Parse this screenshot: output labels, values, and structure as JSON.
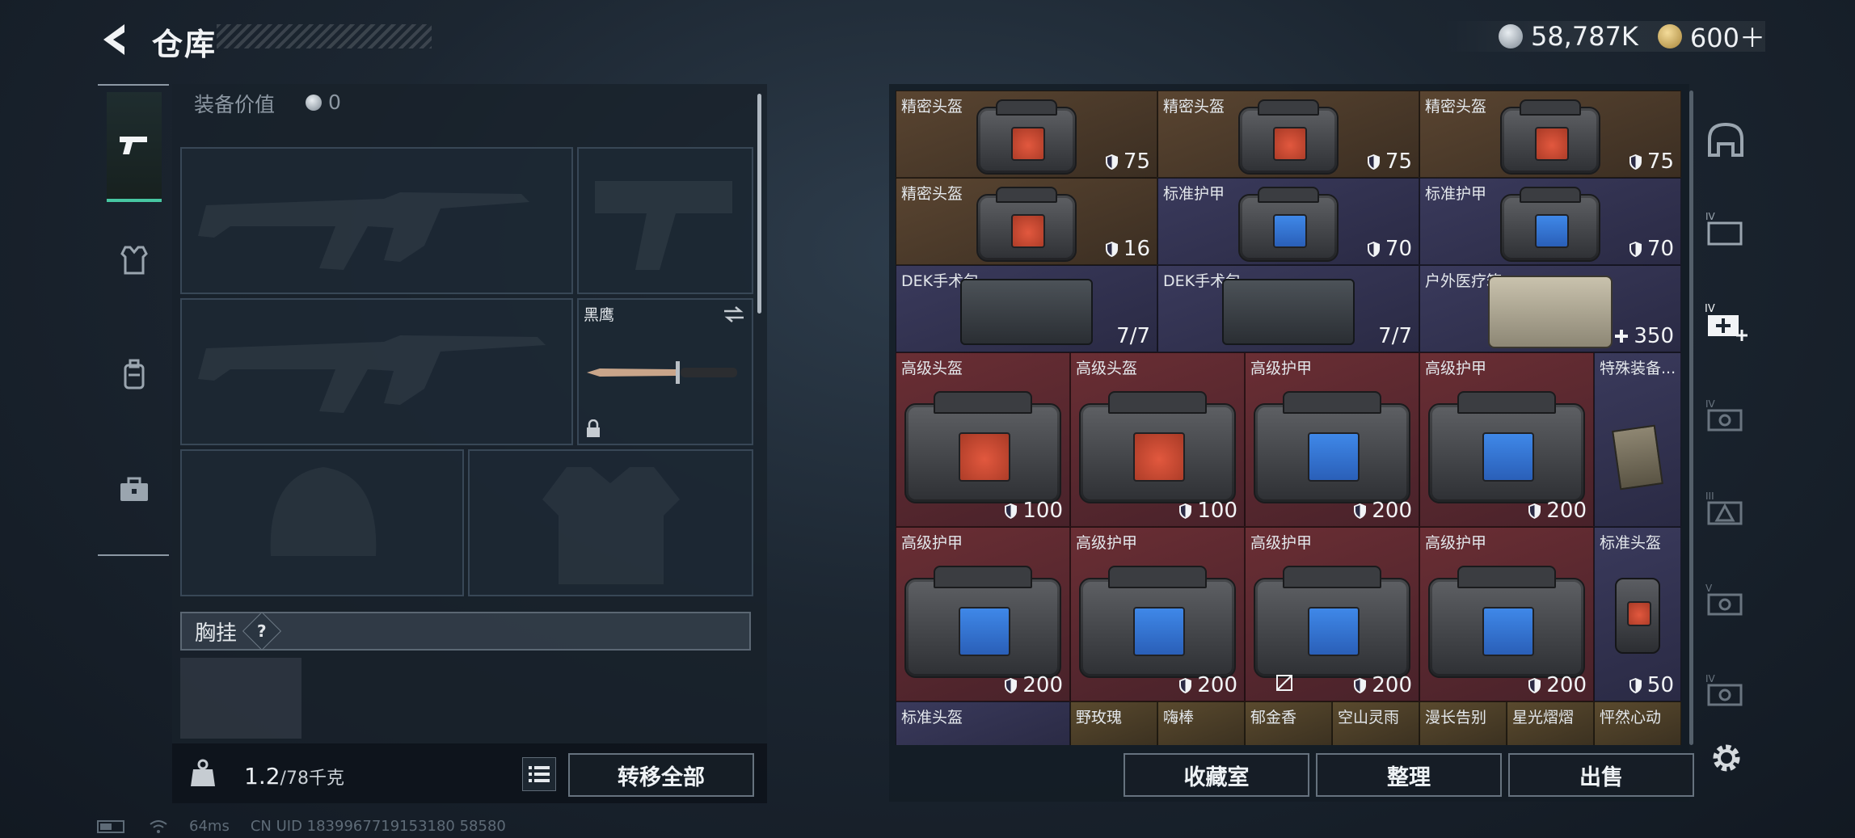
{
  "header": {
    "title": "仓库",
    "silver": "58,787K",
    "gold": "600＋"
  },
  "left_tabs": [
    {
      "icon": "pistol-icon",
      "active": true
    },
    {
      "icon": "armor-vest-icon",
      "active": false
    },
    {
      "icon": "backpack-icon",
      "active": false
    },
    {
      "icon": "toolbox-icon",
      "active": false
    }
  ],
  "loadout": {
    "equip_label": "装备价值",
    "equip_value": "0",
    "melee": {
      "name": "黑鹰"
    },
    "chest_rig_label": "胸挂",
    "help": "?",
    "weight_current": "1.2",
    "weight_max": "/78千克",
    "transfer_all": "转移全部"
  },
  "storage": {
    "rows": [
      [
        {
          "name": "精密头盔",
          "value": "75",
          "bg": "brown",
          "type": "helmet-red"
        },
        {
          "name": "精密头盔",
          "value": "75",
          "bg": "brown",
          "type": "helmet-red"
        },
        {
          "name": "精密头盔",
          "value": "75",
          "bg": "brown",
          "type": "helmet-red"
        }
      ],
      [
        {
          "name": "精密头盔",
          "value": "16",
          "bg": "brown",
          "type": "helmet-red"
        },
        {
          "name": "标准护甲",
          "value": "70",
          "bg": "purple",
          "type": "armor-blue"
        },
        {
          "name": "标准护甲",
          "value": "70",
          "bg": "purple",
          "type": "armor-blue"
        }
      ],
      [
        {
          "name": "DEK手术包",
          "value": "7/7",
          "bg": "purple",
          "type": "kit"
        },
        {
          "name": "DEK手术包",
          "value": "7/7",
          "bg": "purple",
          "type": "kit"
        },
        {
          "name": "户外医疗箱",
          "value": "350",
          "bg": "purple",
          "type": "medbox"
        }
      ]
    ],
    "big_rows": [
      [
        {
          "name": "高级头盔",
          "value": "100",
          "type": "helmet-red"
        },
        {
          "name": "高级头盔",
          "value": "100",
          "type": "helmet-red"
        },
        {
          "name": "高级护甲",
          "value": "200",
          "type": "armor-blue"
        },
        {
          "name": "高级护甲",
          "value": "200",
          "type": "armor-blue"
        }
      ],
      [
        {
          "name": "高级护甲",
          "value": "200",
          "type": "armor-blue"
        },
        {
          "name": "高级护甲",
          "value": "200",
          "type": "armor-blue"
        },
        {
          "name": "高级护甲",
          "value": "200",
          "type": "armor-blue"
        },
        {
          "name": "高级护甲",
          "value": "200",
          "type": "armor-blue"
        }
      ]
    ],
    "narrow": [
      {
        "name": "特殊装备...",
        "value": ""
      },
      {
        "name": "标准头盔",
        "value": "50"
      }
    ],
    "bottom_row": [
      "标准头盔",
      "野玫瑰",
      "嗨棒",
      "郁金香",
      "空山灵雨",
      "漫长告别",
      "星光熠熠",
      "怦然心动"
    ],
    "buttons": {
      "collection": "收藏室",
      "sort": "整理",
      "sell": "出售"
    }
  },
  "right_tabs": [
    "helmet-tab-icon",
    "folder-tab-icon",
    "medical-tab-icon",
    "ammo-tab-icon",
    "triangle-tab-icon",
    "key-tab-icon",
    "misc-tab-icon"
  ],
  "status": {
    "ping": "64ms",
    "uid": "CN UID 1839967719153180 58580"
  },
  "colors": {
    "accent": "#47c7a2",
    "brown": "#5a4531",
    "purple": "#3a3a5c",
    "red": "#6a2e34"
  }
}
